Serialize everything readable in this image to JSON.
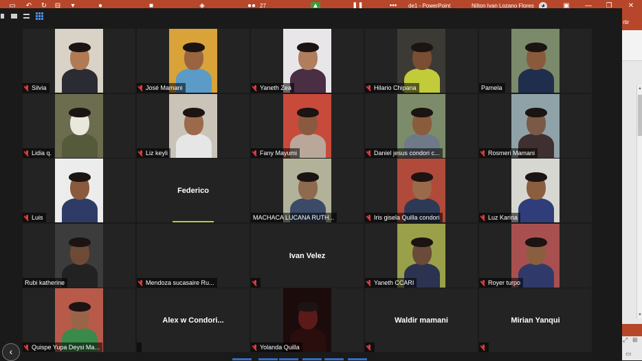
{
  "ppt_titlebar": {
    "doc_label": "de1  -  PowerPoint",
    "user_name": "Nilton Ivan Lozano Flores",
    "participants_count": "27",
    "ribbon_text": "rtir"
  },
  "zoom": {
    "participants": [
      {
        "name": "Silvia",
        "muted": true,
        "video": true,
        "bg": "#d9d2c7",
        "skin": "#b07a55",
        "shirt": "#2b2b33"
      },
      {
        "name": "José Mamani",
        "muted": true,
        "video": true,
        "bg": "#d9a33a",
        "skin": "#9a6440",
        "shirt": "#5c9bc7"
      },
      {
        "name": "Yaneth Zea",
        "muted": true,
        "video": true,
        "bg": "#e9e6ea",
        "skin": "#b07d5d",
        "shirt": "#4a2e44"
      },
      {
        "name": "Hilario Chipana",
        "muted": true,
        "video": true,
        "bg": "#3b3a35",
        "skin": "#7a4e32",
        "shirt": "#c2cb3a"
      },
      {
        "name": "Pamela",
        "muted": false,
        "video": true,
        "bg": "#7a8a6a",
        "skin": "#8a5a3c",
        "shirt": "#1f2e4d"
      },
      {
        "name": "Lidia q.",
        "muted": true,
        "video": true,
        "bg": "#6c6c4e",
        "skin": "#e8e8dd",
        "shirt": "#555a3a"
      },
      {
        "name": "Liz keyli",
        "muted": true,
        "video": true,
        "bg": "#c9c3b8",
        "skin": "#9c6a4a",
        "shirt": "#e6e6e6"
      },
      {
        "name": "Fany Mayumi",
        "muted": true,
        "video": true,
        "bg": "#c84a3a",
        "skin": "#8a5a40",
        "shirt": "#b9a89a"
      },
      {
        "name": "Daniel jesus condori c...",
        "muted": true,
        "video": true,
        "bg": "#7c8c6a",
        "skin": "#8a5c3c",
        "shirt": "#6f7a88"
      },
      {
        "name": "Rosmeri Mamani",
        "muted": true,
        "video": true,
        "bg": "#8fa2a8",
        "skin": "#7a5a46",
        "shirt": "#3e3030"
      },
      {
        "name": "Luis",
        "muted": true,
        "video": true,
        "bg": "#ececec",
        "skin": "#8a5a3e",
        "shirt": "#2d3b66"
      },
      {
        "name": "Federico",
        "muted": false,
        "video": false,
        "speaking": true
      },
      {
        "name": "MACHACA LUCANA RUTH...",
        "muted": false,
        "video": true,
        "bg": "#b2b29a",
        "skin": "#8e6a4e",
        "shirt": "#3b4a66"
      },
      {
        "name": "Iris gisela Quilla condori",
        "muted": true,
        "video": true,
        "bg": "#b04a3a",
        "skin": "#9a6a4a",
        "shirt": "#2e3a55"
      },
      {
        "name": "Luz Karina",
        "muted": true,
        "video": true,
        "bg": "#d7d7d2",
        "skin": "#8c5e40",
        "shirt": "#2f3e7a"
      },
      {
        "name": "Rubi katherine",
        "muted": false,
        "video": true,
        "bg": "#3c3c3c",
        "skin": "#6e4a36",
        "shirt": "#222"
      },
      {
        "name": "Mendoza sucasaire Ru...",
        "muted": true,
        "video": false
      },
      {
        "name": "Ivan Velez",
        "muted": true,
        "video": false,
        "big": true
      },
      {
        "name": "Yaneth CCARI",
        "muted": true,
        "video": true,
        "bg": "#9aa04a",
        "skin": "#6a4a38",
        "shirt": "#2b3350"
      },
      {
        "name": "Royer turpo",
        "muted": true,
        "video": true,
        "bg": "#a85050",
        "skin": "#8c5e40",
        "shirt": "#2f3a6a"
      },
      {
        "name": "Quispe Yupa Deysi Ma...",
        "muted": true,
        "video": true,
        "bg": "#b85a4a",
        "skin": "#9a6448",
        "shirt": "#3a8a4a"
      },
      {
        "name": "Alex w Condori...",
        "muted": false,
        "video": false,
        "big": true
      },
      {
        "name": "Yolanda Quilla",
        "muted": true,
        "video": true,
        "bg": "#1c0b0b",
        "skin": "#5a1a1a",
        "shirt": "#2a0d0d"
      },
      {
        "name": "Waldir mamani",
        "muted": true,
        "video": false,
        "big": true
      },
      {
        "name": "Mirian Yanqui",
        "muted": true,
        "video": false,
        "big": true
      }
    ],
    "back_symbol": "‹"
  }
}
